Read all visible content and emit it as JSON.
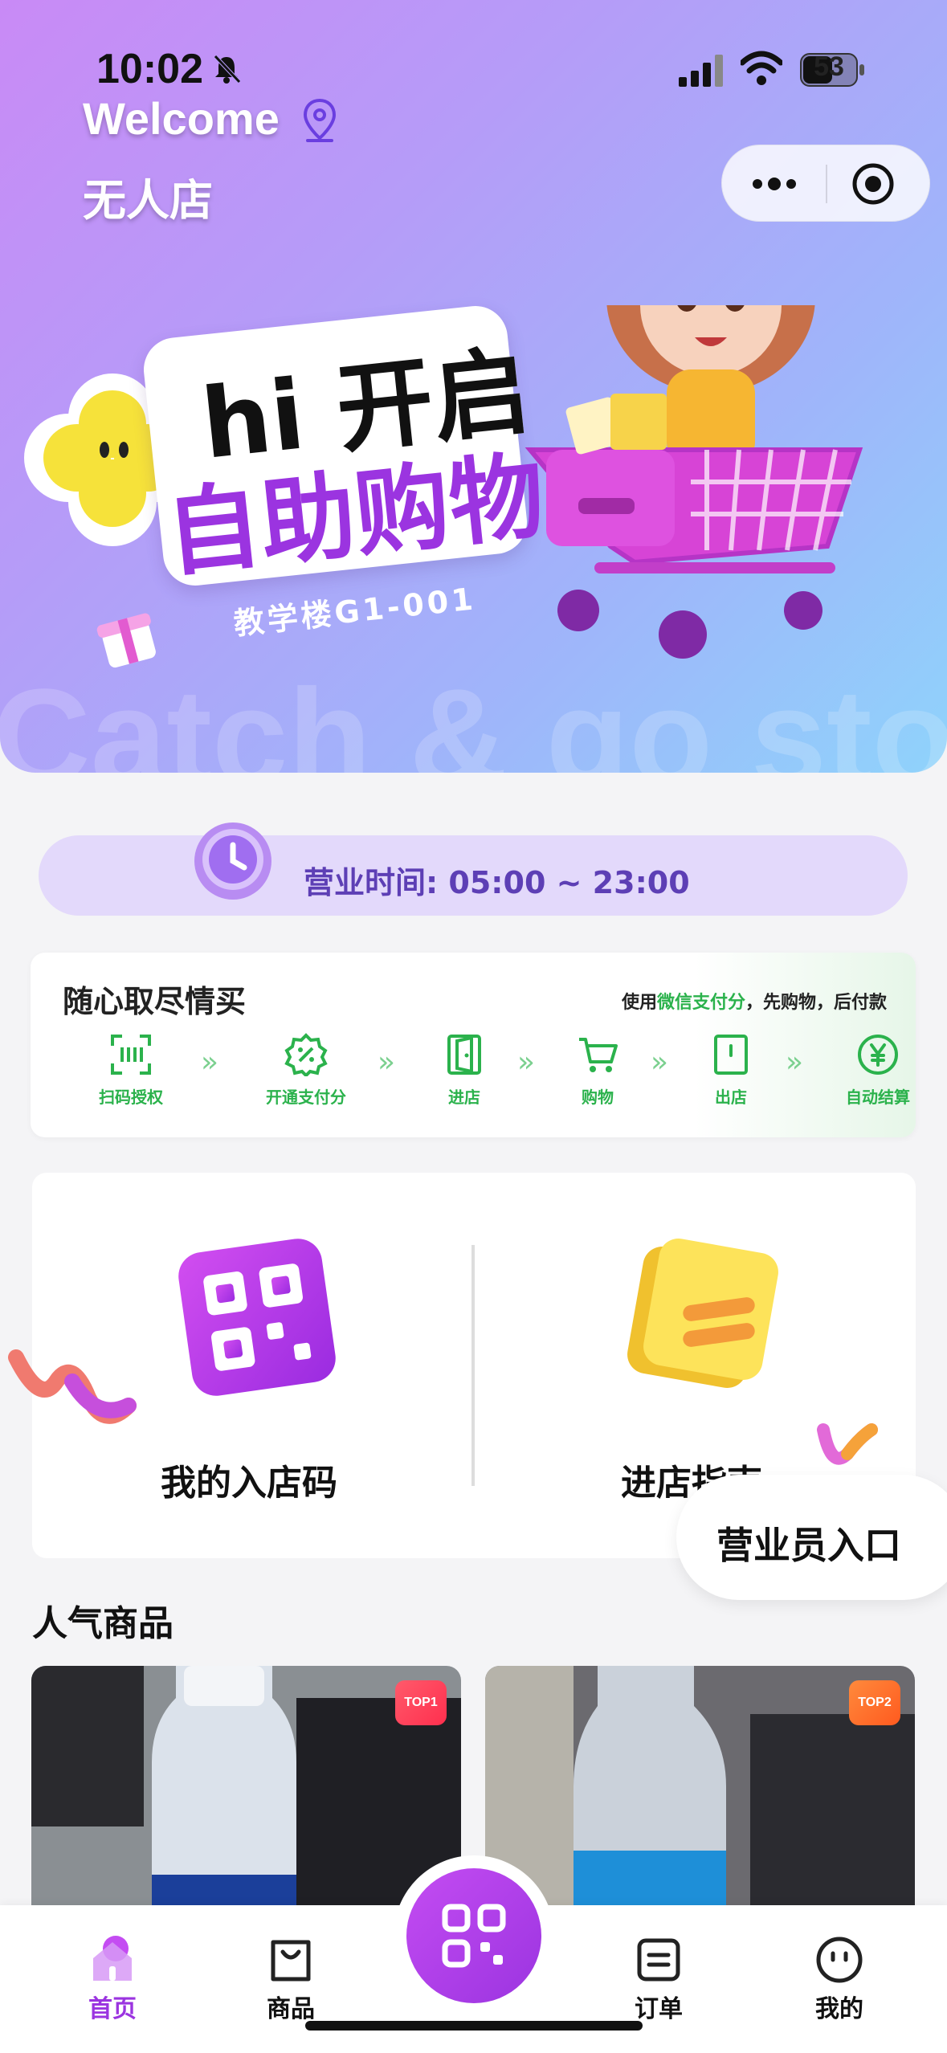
{
  "status": {
    "time": "10:02",
    "battery": "53"
  },
  "header": {
    "welcome": "Welcome",
    "store_name": "无人店"
  },
  "banner": {
    "line1": "hi 开启",
    "line2": "自助购物",
    "location": "教学楼G1-001",
    "watermark": "Catch & go store"
  },
  "hours": {
    "text": "营业时间: 05:00 ~ 23:00"
  },
  "flow": {
    "title": "随心取尽情买",
    "subtitle_prefix": "使用",
    "subtitle_highlight": "微信支付分",
    "subtitle_suffix": "，先购物，后付款",
    "steps": [
      "扫码授权",
      "开通支付分",
      "进店",
      "购物",
      "出店",
      "自动结算"
    ],
    "accent": "#2bb24c"
  },
  "cards": {
    "entry_code": "我的入店码",
    "guide": "进店指南",
    "staff_entry": "营业员入口"
  },
  "popular": {
    "title": "人气商品",
    "items": [
      {
        "badge": "TOP1"
      },
      {
        "badge": "TOP2"
      }
    ]
  },
  "tabbar": {
    "home": "首页",
    "goods": "商品",
    "orders": "订单",
    "mine": "我的"
  },
  "colors": {
    "brand": "#9b34e0",
    "hours_text": "#5d3fb5"
  }
}
